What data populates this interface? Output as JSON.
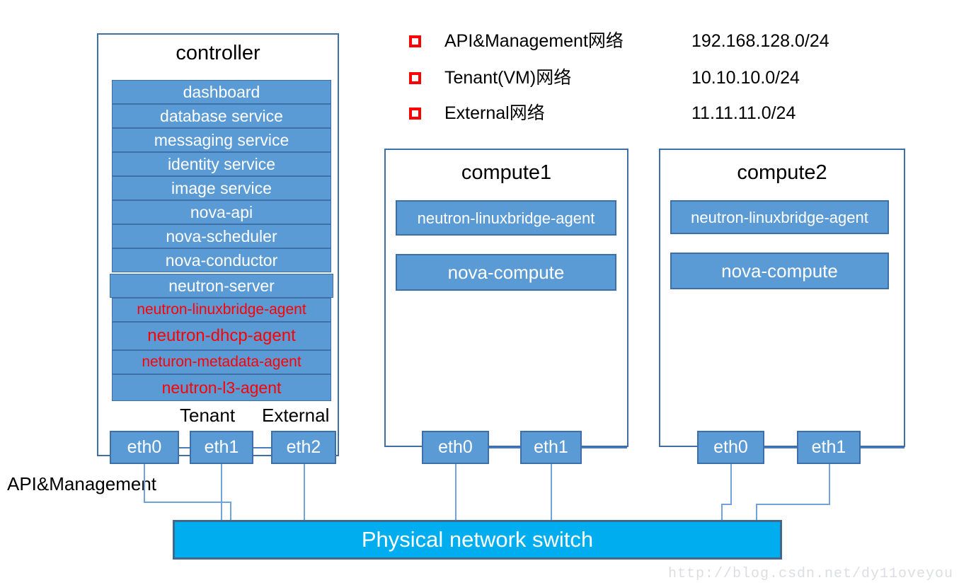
{
  "legend": {
    "items": [
      {
        "name": "API&Management网络",
        "cidr": "192.168.128.0/24"
      },
      {
        "name": "Tenant(VM)网络",
        "cidr": "10.10.10.0/24"
      },
      {
        "name": "External网络",
        "cidr": "11.11.11.0/24"
      }
    ]
  },
  "controller": {
    "title": "controller",
    "services": [
      {
        "label": "dashboard",
        "color": "white"
      },
      {
        "label": "database service",
        "color": "white"
      },
      {
        "label": "messaging service",
        "color": "white"
      },
      {
        "label": "identity service",
        "color": "white"
      },
      {
        "label": "image service",
        "color": "white"
      },
      {
        "label": "nova-api",
        "color": "white"
      },
      {
        "label": "nova-scheduler",
        "color": "white"
      },
      {
        "label": "nova-conductor",
        "color": "white"
      },
      {
        "label": "neutron-server",
        "color": "white"
      },
      {
        "label": "neutron-linuxbridge-agent",
        "color": "red"
      },
      {
        "label": "neutron-dhcp-agent",
        "color": "red"
      },
      {
        "label": "neturon-metadata-agent",
        "color": "red"
      },
      {
        "label": "neutron-l3-agent",
        "color": "red"
      }
    ],
    "ports": [
      {
        "label": "eth0",
        "network": "API&Management"
      },
      {
        "label": "eth1",
        "network": "Tenant"
      },
      {
        "label": "eth2",
        "network": "External"
      }
    ],
    "port_labels": {
      "tenant": "Tenant",
      "external": "External",
      "api_management": "API&Management"
    }
  },
  "compute1": {
    "title": "compute1",
    "services": [
      {
        "label": "neutron-linuxbridge-agent"
      },
      {
        "label": "nova-compute"
      }
    ],
    "ports": [
      {
        "label": "eth0"
      },
      {
        "label": "eth1"
      }
    ]
  },
  "compute2": {
    "title": "compute2",
    "services": [
      {
        "label": "neutron-linuxbridge-agent"
      },
      {
        "label": "nova-compute"
      }
    ],
    "ports": [
      {
        "label": "eth0"
      },
      {
        "label": "eth1"
      }
    ]
  },
  "switch": {
    "label": "Physical network switch"
  },
  "watermark": {
    "text": "http://blog.csdn.net/dy11oveyou"
  },
  "colors": {
    "service_fill": "#5B9BD5",
    "service_border": "#3E6FA8",
    "switch_fill": "#00AEEF",
    "switch_border": "#41698F",
    "highlight_text": "#FF0000",
    "wire": "#6FA3DC"
  }
}
